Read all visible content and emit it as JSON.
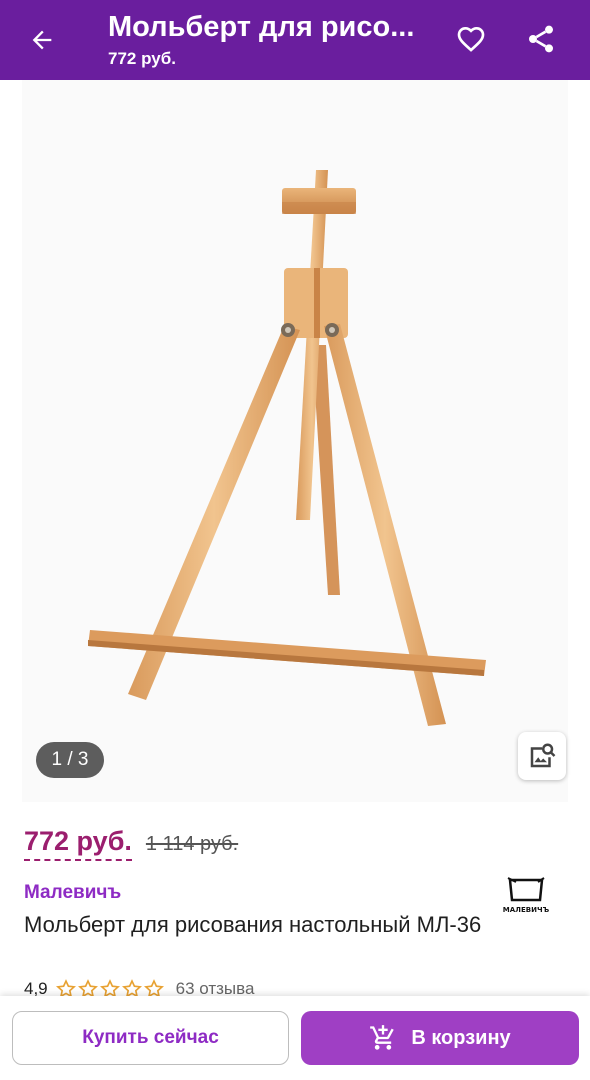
{
  "header": {
    "title": "Мольберт для рисо...",
    "subtitle": "772 руб.",
    "back_icon": "arrow-left-icon",
    "favorite_icon": "heart-icon",
    "share_icon": "share-icon"
  },
  "gallery": {
    "counter": "1 / 3",
    "search_icon": "image-search-icon"
  },
  "product": {
    "price": "772 руб.",
    "old_price": "1 114 руб.",
    "brand": "Малевичъ",
    "brand_logo_text": "МАЛЕВИЧЪ",
    "name": "Мольберт для рисования настольный МЛ-36",
    "rating": "4,9",
    "stars": 5,
    "reviews": "63 отзыва"
  },
  "actions": {
    "buy_now": "Купить сейчас",
    "add_to_cart": "В корзину",
    "cart_icon": "cart-plus-icon"
  },
  "colors": {
    "header_bg": "#6a1e9e",
    "price": "#9b1e6e",
    "brand": "#8e2bc4",
    "cart_button": "#9f3fc4",
    "star": "#e8a233"
  }
}
